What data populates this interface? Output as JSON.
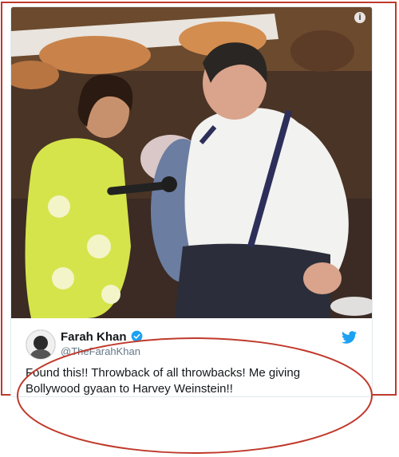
{
  "tweet": {
    "author_name": "Farah Khan",
    "handle": "@TheFarahKhan",
    "text_line1": "Found this!! Throwback of all throwbacks! Me giving",
    "text_line2": "Bollywood gyaan to Harvey Weinstein!!"
  },
  "icons": {
    "info": "info-icon",
    "verified": "verified-badge-icon",
    "brand": "twitter-bird-icon"
  },
  "colors": {
    "annotation_red": "#c0392b",
    "twitter_blue": "#1da1f2"
  }
}
